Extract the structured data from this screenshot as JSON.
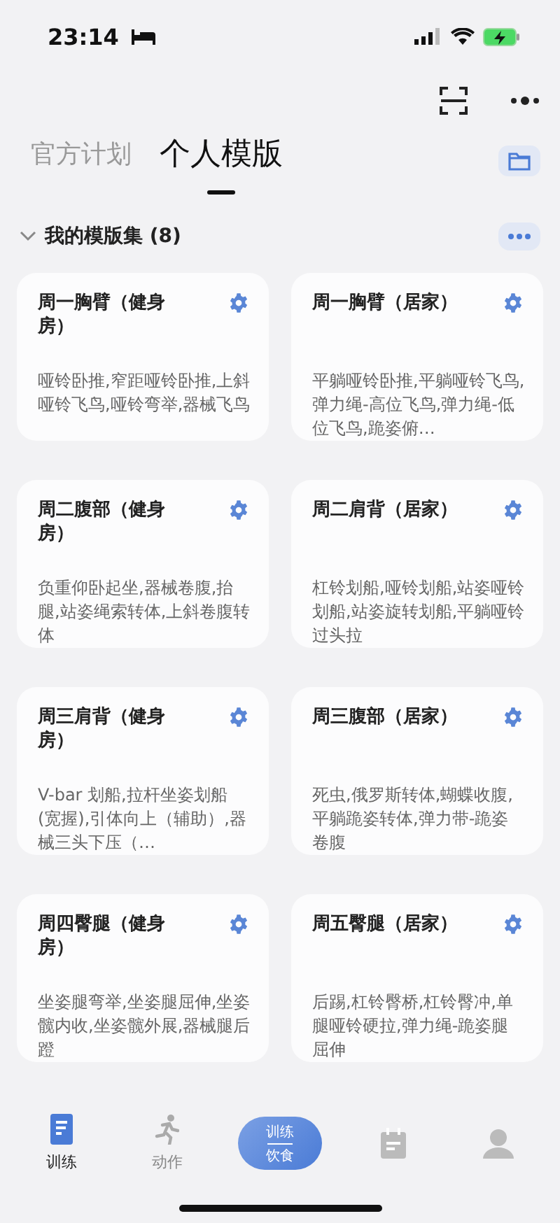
{
  "status_bar": {
    "time": "23:14"
  },
  "tabs": [
    {
      "label": "官方计划",
      "selected": false
    },
    {
      "label": "个人模版",
      "selected": true
    }
  ],
  "section": {
    "title": "我的模版集 (8)",
    "expanded": true
  },
  "templates": [
    {
      "title": "周一胸臂（健身房）",
      "exercises": "哑铃卧推,窄距哑铃卧推,上斜哑铃飞鸟,哑铃弯举,器械飞鸟"
    },
    {
      "title": "周一胸臂（居家）",
      "exercises": "平躺哑铃卧推,平躺哑铃飞鸟,弹力绳-高位飞鸟,弹力绳-低位飞鸟,跪姿俯…"
    },
    {
      "title": "周二腹部（健身房）",
      "exercises": "负重仰卧起坐,器械卷腹,抬腿,站姿绳索转体,上斜卷腹转体"
    },
    {
      "title": "周二肩背（居家）",
      "exercises": "杠铃划船,哑铃划船,站姿哑铃划船,站姿旋转划船,平躺哑铃过头拉"
    },
    {
      "title": "周三肩背（健身房）",
      "exercises": "V-bar 划船,拉杆坐姿划船 (宽握),引体向上（辅助）,器械三头下压（…"
    },
    {
      "title": "周三腹部（居家）",
      "exercises": "死虫,俄罗斯转体,蝴蝶收腹,平躺跪姿转体,弹力带-跪姿卷腹"
    },
    {
      "title": "周四臀腿（健身房）",
      "exercises": "坐姿腿弯举,坐姿腿屈伸,坐姿髋内收,坐姿髋外展,器械腿后蹬"
    },
    {
      "title": "周五臀腿（居家）",
      "exercises": "后踢,杠铃臀桥,杠铃臀冲,单腿哑铃硬拉,弹力绳-跪姿腿屈伸"
    }
  ],
  "bottom_nav": [
    {
      "kind": "icon",
      "label": "训练",
      "selected": true
    },
    {
      "kind": "icon",
      "label": "动作",
      "selected": false
    },
    {
      "kind": "pill",
      "top": "训练",
      "bottom": "饮食",
      "selected": false
    },
    {
      "kind": "icon",
      "selected": false
    },
    {
      "kind": "icon",
      "selected": false
    }
  ]
}
